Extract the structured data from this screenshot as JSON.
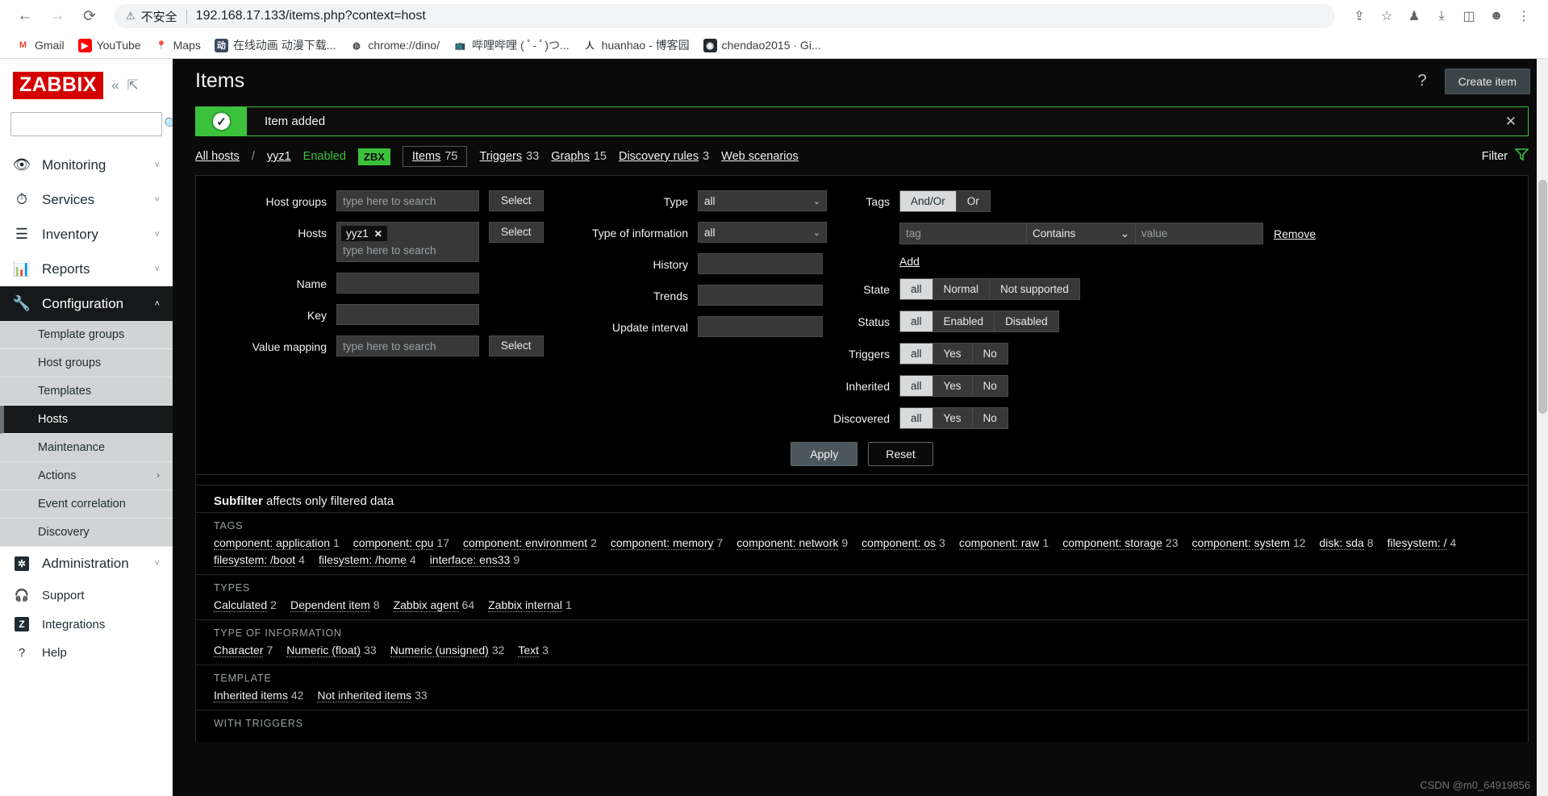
{
  "browser": {
    "back_icon": "←",
    "forward_icon": "→",
    "reload_icon": "⟳",
    "warning_icon": "⚠",
    "not_secure": "不安全",
    "url": "192.168.17.133/items.php?context=host",
    "right_icons": [
      "share-icon",
      "star-icon",
      "person-icon",
      "download-icon",
      "sidepanel-icon",
      "profile-icon",
      "menu-icon"
    ],
    "bookmarks": [
      {
        "label": "Gmail",
        "icon": "M",
        "bg": "#ffffff",
        "fg": "#ea4335"
      },
      {
        "label": "YouTube",
        "icon": "▶",
        "bg": "#ff0000",
        "fg": "#ffffff"
      },
      {
        "label": "Maps",
        "icon": "📍",
        "bg": "#ffffff",
        "fg": "#34a853"
      },
      {
        "label": "在线动画 动漫下载...",
        "icon": "动",
        "bg": "#3b4a63",
        "fg": "#ffffff"
      },
      {
        "label": "chrome://dino/",
        "icon": "◍",
        "bg": "#ffffff",
        "fg": "#3c4043"
      },
      {
        "label": "哔哩哔哩 ( ﾟ- ﾟ)つ...",
        "icon": "tv",
        "bg": "#ffffff",
        "fg": "#00a1d6"
      },
      {
        "label": "huanhao - 博客园",
        "icon": "人",
        "bg": "#ffffff",
        "fg": "#3c4043"
      },
      {
        "label": "chendao2015 · Gi...",
        "icon": "",
        "bg": "#24292e",
        "fg": "#ffffff"
      }
    ]
  },
  "sidebar": {
    "logo": "ZABBIX",
    "collapse_icon": "«",
    "expand_icon": "⇱",
    "search_placeholder": "",
    "search_value": "",
    "nav": [
      {
        "label": "Monitoring",
        "icon": "👁",
        "expandable": true,
        "active": false
      },
      {
        "label": "Services",
        "icon": "⏱",
        "expandable": true,
        "active": false
      },
      {
        "label": "Inventory",
        "icon": "☰",
        "expandable": true,
        "active": false
      },
      {
        "label": "Reports",
        "icon": "📊",
        "expandable": true,
        "active": false
      },
      {
        "label": "Configuration",
        "icon": "🔧",
        "expandable": true,
        "active": true
      }
    ],
    "submenu": [
      {
        "label": "Template groups",
        "active": false
      },
      {
        "label": "Host groups",
        "active": false
      },
      {
        "label": "Templates",
        "active": false
      },
      {
        "label": "Hosts",
        "active": true
      },
      {
        "label": "Maintenance",
        "active": false
      },
      {
        "label": "Actions",
        "active": false,
        "has_arrow": true
      },
      {
        "label": "Event correlation",
        "active": false
      },
      {
        "label": "Discovery",
        "active": false
      }
    ],
    "admin": {
      "label": "Administration",
      "icon": "⚙"
    },
    "bottom": [
      {
        "label": "Support",
        "icon": "🎧"
      },
      {
        "label": "Integrations",
        "icon": "Z"
      },
      {
        "label": "Help",
        "icon": "?"
      }
    ]
  },
  "header": {
    "title": "Items",
    "help_icon": "?",
    "create_button": "Create item"
  },
  "message": {
    "text": "Item added",
    "check_icon": "✓",
    "close_icon": "✕"
  },
  "breadcrumb": {
    "all_hosts": "All hosts",
    "separator": "/",
    "host": "yyz1",
    "status": "Enabled",
    "zbx_badge": "ZBX",
    "tabs": [
      {
        "label": "Items",
        "count": "75",
        "active": true
      },
      {
        "label": "Triggers",
        "count": "33",
        "active": false
      },
      {
        "label": "Graphs",
        "count": "15",
        "active": false
      },
      {
        "label": "Discovery rules",
        "count": "3",
        "active": false
      },
      {
        "label": "Web scenarios",
        "count": "",
        "active": false
      }
    ],
    "filter_label": "Filter",
    "filter_icon": "funnel-icon"
  },
  "filter": {
    "host_groups": {
      "label": "Host groups",
      "placeholder": "type here to search",
      "value": "",
      "select": "Select"
    },
    "hosts": {
      "label": "Hosts",
      "pill": "yyz1",
      "pill_remove": "✕",
      "placeholder": "type here to search",
      "select": "Select"
    },
    "name": {
      "label": "Name",
      "value": ""
    },
    "key": {
      "label": "Key",
      "value": ""
    },
    "value_mapping": {
      "label": "Value mapping",
      "placeholder": "type here to search",
      "value": "",
      "select": "Select"
    },
    "type": {
      "label": "Type",
      "value": "all"
    },
    "type_of_information": {
      "label": "Type of information",
      "value": "all"
    },
    "history": {
      "label": "History",
      "value": ""
    },
    "trends": {
      "label": "Trends",
      "value": ""
    },
    "update_interval": {
      "label": "Update interval",
      "value": ""
    },
    "tags": {
      "label": "Tags",
      "modes": [
        {
          "label": "And/Or",
          "selected": true
        },
        {
          "label": "Or",
          "selected": false
        }
      ],
      "tag_placeholder": "tag",
      "tag_value": "",
      "operator": "Contains",
      "value_placeholder": "value",
      "value_value": "",
      "remove": "Remove",
      "add": "Add"
    },
    "state": {
      "label": "State",
      "options": [
        {
          "label": "all",
          "selected": true
        },
        {
          "label": "Normal",
          "selected": false
        },
        {
          "label": "Not supported",
          "selected": false
        }
      ]
    },
    "status": {
      "label": "Status",
      "options": [
        {
          "label": "all",
          "selected": true
        },
        {
          "label": "Enabled",
          "selected": false
        },
        {
          "label": "Disabled",
          "selected": false
        }
      ]
    },
    "triggers": {
      "label": "Triggers",
      "options": [
        {
          "label": "all",
          "selected": true
        },
        {
          "label": "Yes",
          "selected": false
        },
        {
          "label": "No",
          "selected": false
        }
      ]
    },
    "inherited": {
      "label": "Inherited",
      "options": [
        {
          "label": "all",
          "selected": true
        },
        {
          "label": "Yes",
          "selected": false
        },
        {
          "label": "No",
          "selected": false
        }
      ]
    },
    "discovered": {
      "label": "Discovered",
      "options": [
        {
          "label": "all",
          "selected": true
        },
        {
          "label": "Yes",
          "selected": false
        },
        {
          "label": "No",
          "selected": false
        }
      ]
    },
    "apply": "Apply",
    "reset": "Reset"
  },
  "subfilter": {
    "heading_bold": "Subfilter",
    "heading_rest": " affects only filtered data",
    "sections": [
      {
        "title": "TAGS",
        "items": [
          {
            "name": "component: application",
            "count": "1"
          },
          {
            "name": "component: cpu",
            "count": "17"
          },
          {
            "name": "component: environment",
            "count": "2"
          },
          {
            "name": "component: memory",
            "count": "7"
          },
          {
            "name": "component: network",
            "count": "9"
          },
          {
            "name": "component: os",
            "count": "3"
          },
          {
            "name": "component: raw",
            "count": "1"
          },
          {
            "name": "component: storage",
            "count": "23"
          },
          {
            "name": "component: system",
            "count": "12"
          },
          {
            "name": "disk: sda",
            "count": "8"
          },
          {
            "name": "filesystem: /",
            "count": "4"
          },
          {
            "name": "filesystem: /boot",
            "count": "4"
          },
          {
            "name": "filesystem: /home",
            "count": "4"
          },
          {
            "name": "interface: ens33",
            "count": "9"
          }
        ]
      },
      {
        "title": "TYPES",
        "items": [
          {
            "name": "Calculated",
            "count": "2"
          },
          {
            "name": "Dependent item",
            "count": "8"
          },
          {
            "name": "Zabbix agent",
            "count": "64"
          },
          {
            "name": "Zabbix internal",
            "count": "1"
          }
        ]
      },
      {
        "title": "TYPE OF INFORMATION",
        "items": [
          {
            "name": "Character",
            "count": "7"
          },
          {
            "name": "Numeric (float)",
            "count": "33"
          },
          {
            "name": "Numeric (unsigned)",
            "count": "32"
          },
          {
            "name": "Text",
            "count": "3"
          }
        ]
      },
      {
        "title": "TEMPLATE",
        "items": [
          {
            "name": "Inherited items",
            "count": "42"
          },
          {
            "name": "Not inherited items",
            "count": "33"
          }
        ]
      },
      {
        "title": "WITH TRIGGERS",
        "items": []
      }
    ]
  },
  "watermark": "CSDN @m0_64919856"
}
